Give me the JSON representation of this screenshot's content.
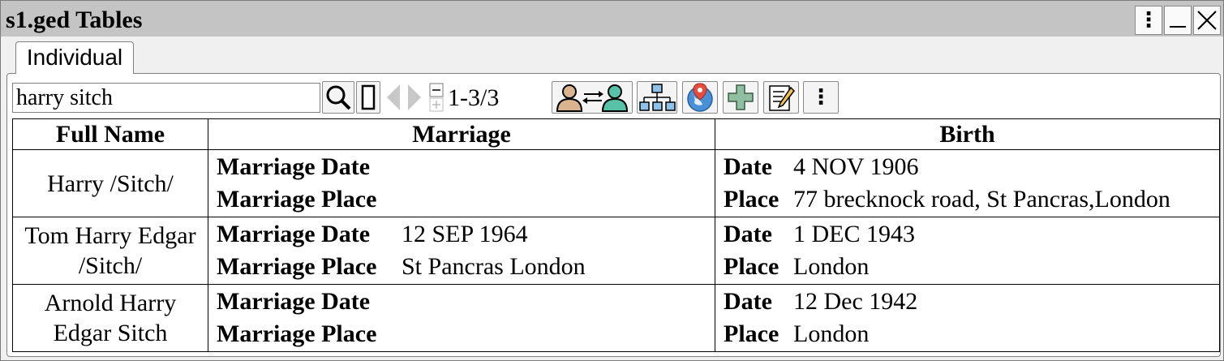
{
  "window": {
    "title": "s1.ged Tables",
    "controls": {
      "menu": "⋮",
      "minimize": "—",
      "close": "✕"
    }
  },
  "tabs": [
    {
      "label": "Individual",
      "active": true
    }
  ],
  "toolbar": {
    "search_value": "harry sitch",
    "count_text": "1-3/3",
    "icons": [
      "search-icon",
      "filter-icon",
      "prev-icon",
      "next-icon",
      "expand-collapse-icon",
      "relationship-icon",
      "tree-icon",
      "map-icon",
      "add-icon",
      "edit-icon",
      "more-icon"
    ]
  },
  "table": {
    "columns": [
      "Full Name",
      "Marriage",
      "Birth"
    ],
    "rows": [
      {
        "name": "Harry /Sitch/",
        "marriage_date_label": "Marriage Date",
        "marriage_date": "",
        "marriage_place_label": "Marriage Place",
        "marriage_place": "",
        "birth_date_label": "Date",
        "birth_date": "4 NOV 1906",
        "birth_place_label": "Place",
        "birth_place": "77 brecknock road, St Pancras,London"
      },
      {
        "name": "Tom Harry Edgar /Sitch/",
        "marriage_date_label": "Marriage Date",
        "marriage_date": "12 SEP 1964",
        "marriage_place_label": "Marriage Place",
        "marriage_place": "St Pancras London",
        "birth_date_label": "Date",
        "birth_date": "1 DEC 1943",
        "birth_place_label": "Place",
        "birth_place": "London"
      },
      {
        "name": "Arnold Harry Edgar Sitch",
        "marriage_date_label": "Marriage Date",
        "marriage_date": "",
        "marriage_place_label": "Marriage Place",
        "marriage_place": "",
        "birth_date_label": "Date",
        "birth_date": "12 Dec 1942",
        "birth_place_label": "Place",
        "birth_place": "London"
      }
    ]
  }
}
